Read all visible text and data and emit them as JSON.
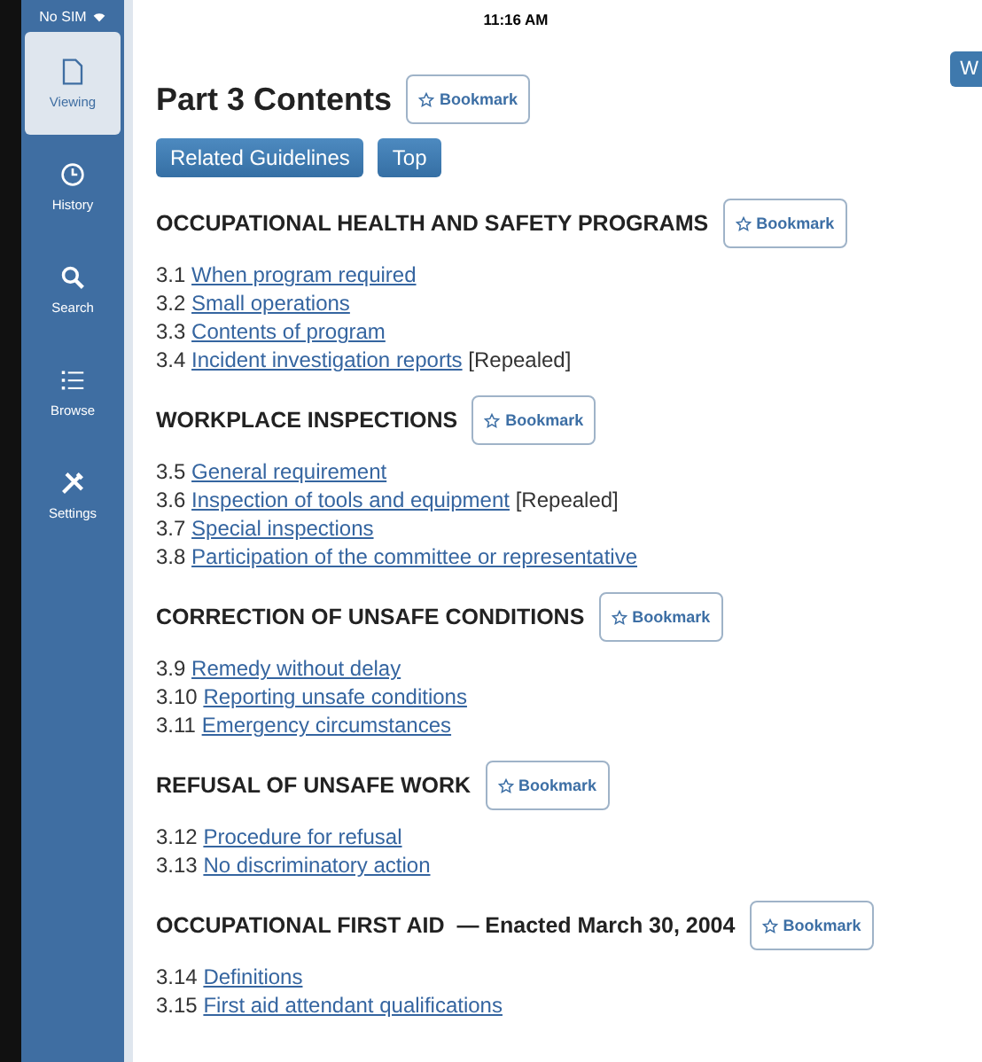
{
  "status_bar": {
    "carrier": "No SIM",
    "time": "11:16 AM"
  },
  "sidebar": {
    "items": [
      {
        "label": "Viewing",
        "selected": true
      },
      {
        "label": "History",
        "selected": false
      },
      {
        "label": "Search",
        "selected": false
      },
      {
        "label": "Browse",
        "selected": false
      },
      {
        "label": "Settings",
        "selected": false
      }
    ]
  },
  "corner_button": "W",
  "title": "Part 3 Contents",
  "title_bookmark": "Bookmark",
  "buttons": [
    "Related Guidelines",
    "Top"
  ],
  "sections": [
    {
      "heading": "OCCUPATIONAL HEALTH AND SAFETY PROGRAMS",
      "bookmark": "Bookmark",
      "items": [
        {
          "number": "3.1",
          "link": "When program required"
        },
        {
          "number": "3.2",
          "link": "Small operations"
        },
        {
          "number": "3.3",
          "link": "Contents of program"
        },
        {
          "number": "3.4",
          "link": "Incident investigation reports",
          "note": "[Repealed]"
        }
      ]
    },
    {
      "heading": "WORKPLACE INSPECTIONS",
      "bookmark": "Bookmark",
      "items": [
        {
          "number": "3.5",
          "link": "General requirement"
        },
        {
          "number": "3.6",
          "link": "Inspection of tools and equipment",
          "note": "[Repealed]"
        },
        {
          "number": "3.7",
          "link": "Special inspections"
        },
        {
          "number": "3.8",
          "link": "Participation of the committee or representative"
        }
      ]
    },
    {
      "heading": "CORRECTION OF UNSAFE CONDITIONS",
      "bookmark": "Bookmark",
      "items": [
        {
          "number": "3.9",
          "link": "Remedy without delay"
        },
        {
          "number": "3.10",
          "link": "Reporting unsafe conditions"
        },
        {
          "number": "3.11",
          "link": "Emergency circumstances"
        }
      ]
    },
    {
      "heading": "REFUSAL OF UNSAFE WORK",
      "bookmark": "Bookmark",
      "items": [
        {
          "number": "3.12",
          "link": "Procedure for refusal"
        },
        {
          "number": "3.13",
          "link": "No discriminatory action"
        }
      ]
    },
    {
      "heading": "OCCUPATIONAL FIRST AID",
      "enacted": "— Enacted March 30, 2004",
      "bookmark": "Bookmark",
      "items": [
        {
          "number": "3.14",
          "link": "Definitions"
        },
        {
          "number": "3.15",
          "link": "First aid attendant qualifications"
        }
      ]
    }
  ]
}
